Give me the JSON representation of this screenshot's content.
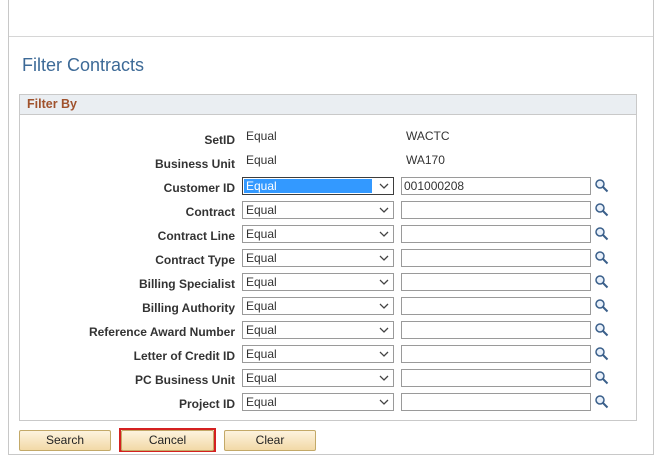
{
  "page": {
    "title": "Filter Contracts"
  },
  "filter": {
    "header": "Filter By",
    "static_rows": [
      {
        "label": "SetID",
        "operator": "Equal",
        "value": "WACTC"
      },
      {
        "label": "Business Unit",
        "operator": "Equal",
        "value": "WA170"
      }
    ],
    "rows": [
      {
        "label": "Customer ID",
        "operator": "Equal",
        "value": "001000208",
        "focused": true
      },
      {
        "label": "Contract",
        "operator": "Equal",
        "value": ""
      },
      {
        "label": "Contract Line",
        "operator": "Equal",
        "value": ""
      },
      {
        "label": "Contract Type",
        "operator": "Equal",
        "value": ""
      },
      {
        "label": "Billing Specialist",
        "operator": "Equal",
        "value": ""
      },
      {
        "label": "Billing Authority",
        "operator": "Equal",
        "value": ""
      },
      {
        "label": "Reference Award Number",
        "operator": "Equal",
        "value": ""
      },
      {
        "label": "Letter of Credit ID",
        "operator": "Equal",
        "value": ""
      },
      {
        "label": "PC Business Unit",
        "operator": "Equal",
        "value": ""
      },
      {
        "label": "Project ID",
        "operator": "Equal",
        "value": ""
      }
    ]
  },
  "buttons": {
    "search": "Search",
    "cancel": "Cancel",
    "clear": "Clear"
  },
  "colors": {
    "title": "#3d6a97",
    "section_header": "#a0522d",
    "highlight": "#3399ff",
    "cancel_outline": "#d42020"
  },
  "icons": {
    "lookup": "magnifier-icon",
    "dropdown": "chevron-down-icon"
  }
}
